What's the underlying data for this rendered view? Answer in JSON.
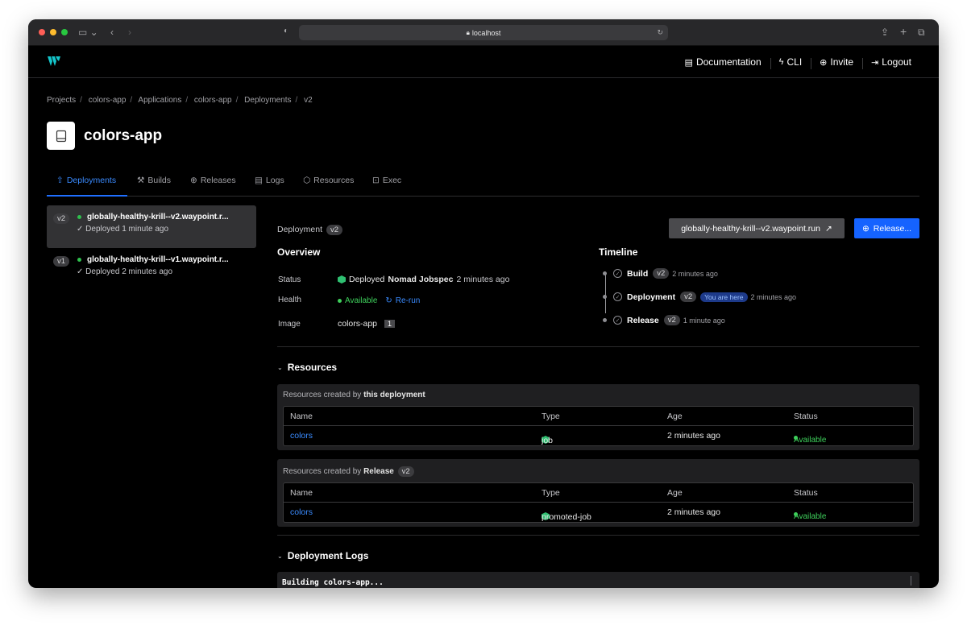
{
  "browser": {
    "url": "localhost",
    "traffic_colors": [
      "#ff5f57",
      "#febc2e",
      "#28c840"
    ]
  },
  "topnav": [
    {
      "icon": "document-icon",
      "label": "Documentation"
    },
    {
      "icon": "bolt-icon",
      "label": "CLI"
    },
    {
      "icon": "plus-circle-icon",
      "label": "Invite"
    },
    {
      "icon": "logout-icon",
      "label": "Logout"
    }
  ],
  "breadcrumb": [
    "Projects",
    "colors-app",
    "Applications",
    "colors-app",
    "Deployments",
    "v2"
  ],
  "page_title": "colors-app",
  "tabs": [
    {
      "label": "Deployments",
      "icon": "upload-icon",
      "active": true
    },
    {
      "label": "Builds",
      "icon": "hammer-icon",
      "active": false
    },
    {
      "label": "Releases",
      "icon": "globe-icon",
      "active": false
    },
    {
      "label": "Logs",
      "icon": "list-icon",
      "active": false
    },
    {
      "label": "Resources",
      "icon": "cube-icon",
      "active": false
    },
    {
      "label": "Exec",
      "icon": "terminal-icon",
      "active": false
    }
  ],
  "deployments": [
    {
      "version": "v2",
      "name": "globally-healthy-krill--v2.waypoint.r...",
      "status": "Deployed 1 minute ago",
      "selected": true
    },
    {
      "version": "v1",
      "name": "globally-healthy-krill--v1.waypoint.r...",
      "status": "Deployed 2 minutes ago",
      "selected": false
    }
  ],
  "detail": {
    "deployment_label": "Deployment",
    "deployment_version": "v2",
    "url_button": "globally-healthy-krill--v2.waypoint.run",
    "release_button": "Release...",
    "overview_title": "Overview",
    "status_label": "Status",
    "status_prefix": "Deployed",
    "status_platform": "Nomad Jobspec",
    "status_time": "2 minutes ago",
    "health_label": "Health",
    "health_value": "Available",
    "rerun_label": "Re-run",
    "image_label": "Image",
    "image_name": "colors-app",
    "image_tag": "1",
    "timeline_title": "Timeline",
    "timeline": [
      {
        "name": "Build",
        "version": "v2",
        "time": "2 minutes ago",
        "here": ""
      },
      {
        "name": "Deployment",
        "version": "v2",
        "time": "2 minutes ago",
        "here": "You are here"
      },
      {
        "name": "Release",
        "version": "v2",
        "time": "1 minute ago",
        "here": ""
      }
    ]
  },
  "resources": {
    "title": "Resources",
    "card1": {
      "prefix": "Resources created by",
      "bold": "this deployment",
      "version": ""
    },
    "card2": {
      "prefix": "Resources created by",
      "bold": "Release",
      "version": "v2"
    },
    "columns": [
      "Name",
      "Type",
      "Age",
      "Status"
    ],
    "rows1": [
      {
        "name": "colors",
        "type": "job",
        "age": "2 minutes ago",
        "status": "Available"
      }
    ],
    "rows2": [
      {
        "name": "colors",
        "type": "promoted-job",
        "age": "2 minutes ago",
        "status": "Available"
      }
    ]
  },
  "logs": {
    "title": "Deployment Logs",
    "first_line": "Building colors-app..."
  }
}
